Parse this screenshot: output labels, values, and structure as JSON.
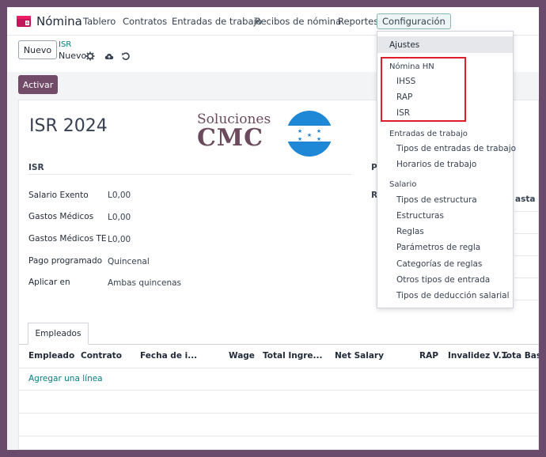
{
  "topbar": {
    "app_name": "Nómina",
    "menu": [
      "Tablero",
      "Contratos",
      "Entradas de trabajo",
      "Recibos de nómina",
      "Reportes",
      "Configuración"
    ],
    "active_menu": "Configuración"
  },
  "control": {
    "new_button": "Nuevo",
    "breadcrumb_parent": "ISR",
    "breadcrumb_current": "Nuevo",
    "icons": [
      "gear-icon",
      "cloud-save-icon",
      "undo-icon"
    ]
  },
  "form": {
    "activate_button": "Activar",
    "title": "ISR 2024",
    "logo_line1": "Soluciones",
    "logo_line2": "CMC",
    "section_isr": "ISR",
    "section_right_pa": "PA",
    "section_right_ra": "RA",
    "right_col_header": "asta",
    "fields": [
      {
        "label": "Salario Exento",
        "value": "L0,00"
      },
      {
        "label": "Gastos Médicos",
        "value": "L0,00"
      },
      {
        "label": "Gastos Médicos TE",
        "value": "L0,00"
      },
      {
        "label": "Pago programado",
        "value": "Quincenal"
      },
      {
        "label": "Aplicar en",
        "value": "Ambas quincenas"
      }
    ],
    "tab": "Empleados",
    "columns": [
      "Empleado",
      "Contrato",
      "Fecha de i...",
      "Wage",
      "Total Ingre...",
      "Net Salary",
      "RAP",
      "Invalidez V...",
      "Tota Base"
    ],
    "add_line": "Agregar una línea"
  },
  "dropdown": {
    "ajustes": "Ajustes",
    "groups": [
      {
        "header": "Nómina HN",
        "items": [
          "IHSS",
          "RAP",
          "ISR"
        ]
      },
      {
        "header": "Entradas de trabajo",
        "items": [
          "Tipos de entradas de trabajo",
          "Horarios de trabajo"
        ]
      },
      {
        "header": "Salario",
        "items": [
          "Tipos de estructura",
          "Estructuras",
          "Reglas",
          "Parámetros de regla",
          "Categorías de reglas",
          "Otros tipos de entrada",
          "Tipos de deducción salarial"
        ]
      }
    ]
  },
  "colors": {
    "frame": "#6a4b6b",
    "primary": "#714b67",
    "link": "#017e84",
    "highlight": "#e11d2b",
    "flag_blue": "#1e88d6"
  }
}
